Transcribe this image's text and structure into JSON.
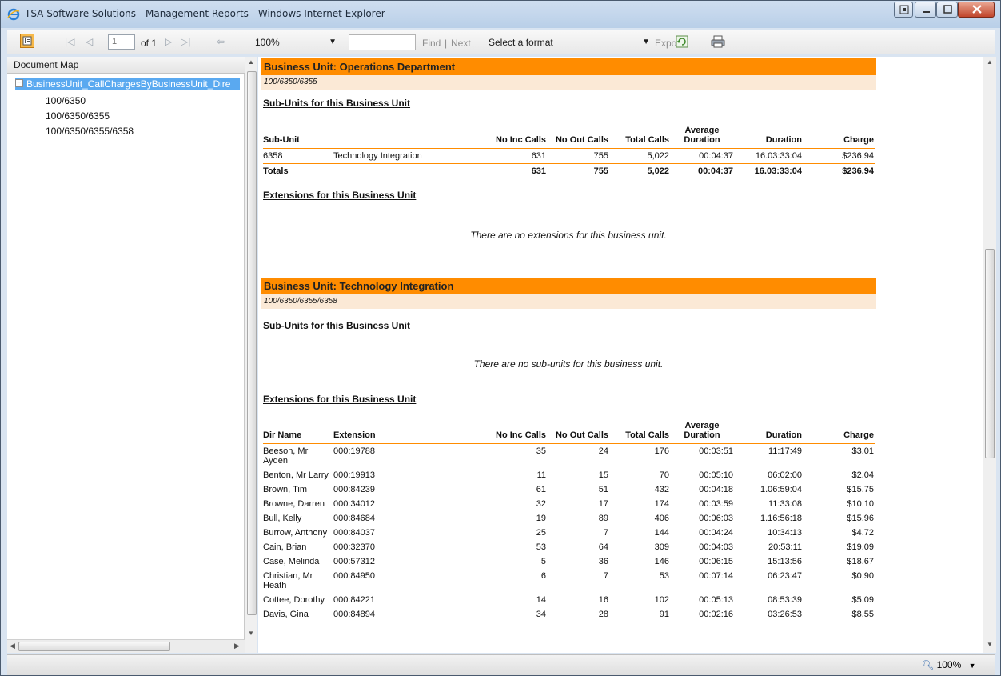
{
  "window": {
    "title": "TSA Software Solutions - Management Reports - Windows Internet Explorer"
  },
  "toolbar": {
    "page_value": "1",
    "of_pages": "of 1",
    "zoom": "100%",
    "find_label": "Find",
    "separator": "|",
    "next_label": "Next",
    "format_placeholder": "Select a format",
    "export_label": "Export"
  },
  "docmap": {
    "header": "Document Map",
    "root_label": "BusinessUnit_CallChargesByBusinessUnit_Dire",
    "items": [
      "100/6350",
      "100/6350/6355",
      "100/6350/6355/6358"
    ]
  },
  "report": {
    "bu1": {
      "header": "Business Unit: Operations Department",
      "path": "100/6350/6355",
      "subunits_title": "Sub-Units for this Business Unit",
      "sub_columns": [
        "Sub-Unit",
        "",
        "No Inc Calls",
        "No Out Calls",
        "Total Calls",
        "Average Duration",
        "Duration",
        "Charge"
      ],
      "sub_rows": [
        [
          "6358",
          "Technology Integration",
          "631",
          "755",
          "5,022",
          "00:04:37",
          "16.03:33:04",
          "$236.94"
        ]
      ],
      "totals": [
        "Totals",
        "",
        "631",
        "755",
        "5,022",
        "00:04:37",
        "16.03:33:04",
        "$236.94"
      ],
      "extensions_title": "Extensions for this Business Unit",
      "no_extensions": "There are no extensions for this business unit."
    },
    "bu2": {
      "header": "Business Unit: Technology Integration",
      "path": "100/6350/6355/6358",
      "subunits_title": "Sub-Units for this Business Unit",
      "no_subunits": "There are no sub-units for this business unit.",
      "extensions_title": "Extensions for this Business Unit",
      "ext_columns": [
        "Dir Name",
        "Extension",
        "No Inc Calls",
        "No Out Calls",
        "Total Calls",
        "Average Duration",
        "Duration",
        "Charge"
      ],
      "ext_rows": [
        [
          "Beeson, Mr Ayden",
          "000:19788",
          "35",
          "24",
          "176",
          "00:03:51",
          "11:17:49",
          "$3.01"
        ],
        [
          "Benton, Mr Larry",
          "000:19913",
          "11",
          "15",
          "70",
          "00:05:10",
          "06:02:00",
          "$2.04"
        ],
        [
          "Brown, Tim",
          "000:84239",
          "61",
          "51",
          "432",
          "00:04:18",
          "1.06:59:04",
          "$15.75"
        ],
        [
          "Browne, Darren",
          "000:34012",
          "32",
          "17",
          "174",
          "00:03:59",
          "11:33:08",
          "$10.10"
        ],
        [
          "Bull, Kelly",
          "000:84684",
          "19",
          "89",
          "406",
          "00:06:03",
          "1.16:56:18",
          "$15.96"
        ],
        [
          "Burrow, Anthony",
          "000:84037",
          "25",
          "7",
          "144",
          "00:04:24",
          "10:34:13",
          "$4.72"
        ],
        [
          "Cain, Brian",
          "000:32370",
          "53",
          "64",
          "309",
          "00:04:03",
          "20:53:11",
          "$19.09"
        ],
        [
          "Case, Melinda",
          "000:57312",
          "5",
          "36",
          "146",
          "00:06:15",
          "15:13:56",
          "$18.67"
        ],
        [
          "Christian, Mr Heath",
          "000:84950",
          "6",
          "7",
          "53",
          "00:07:14",
          "06:23:47",
          "$0.90"
        ],
        [
          "Cottee, Dorothy",
          "000:84221",
          "14",
          "16",
          "102",
          "00:05:13",
          "08:53:39",
          "$5.09"
        ],
        [
          "Davis, Gina",
          "000:84894",
          "34",
          "28",
          "91",
          "00:02:16",
          "03:26:53",
          "$8.55"
        ]
      ]
    }
  },
  "statusbar": {
    "zoom": "100%"
  }
}
